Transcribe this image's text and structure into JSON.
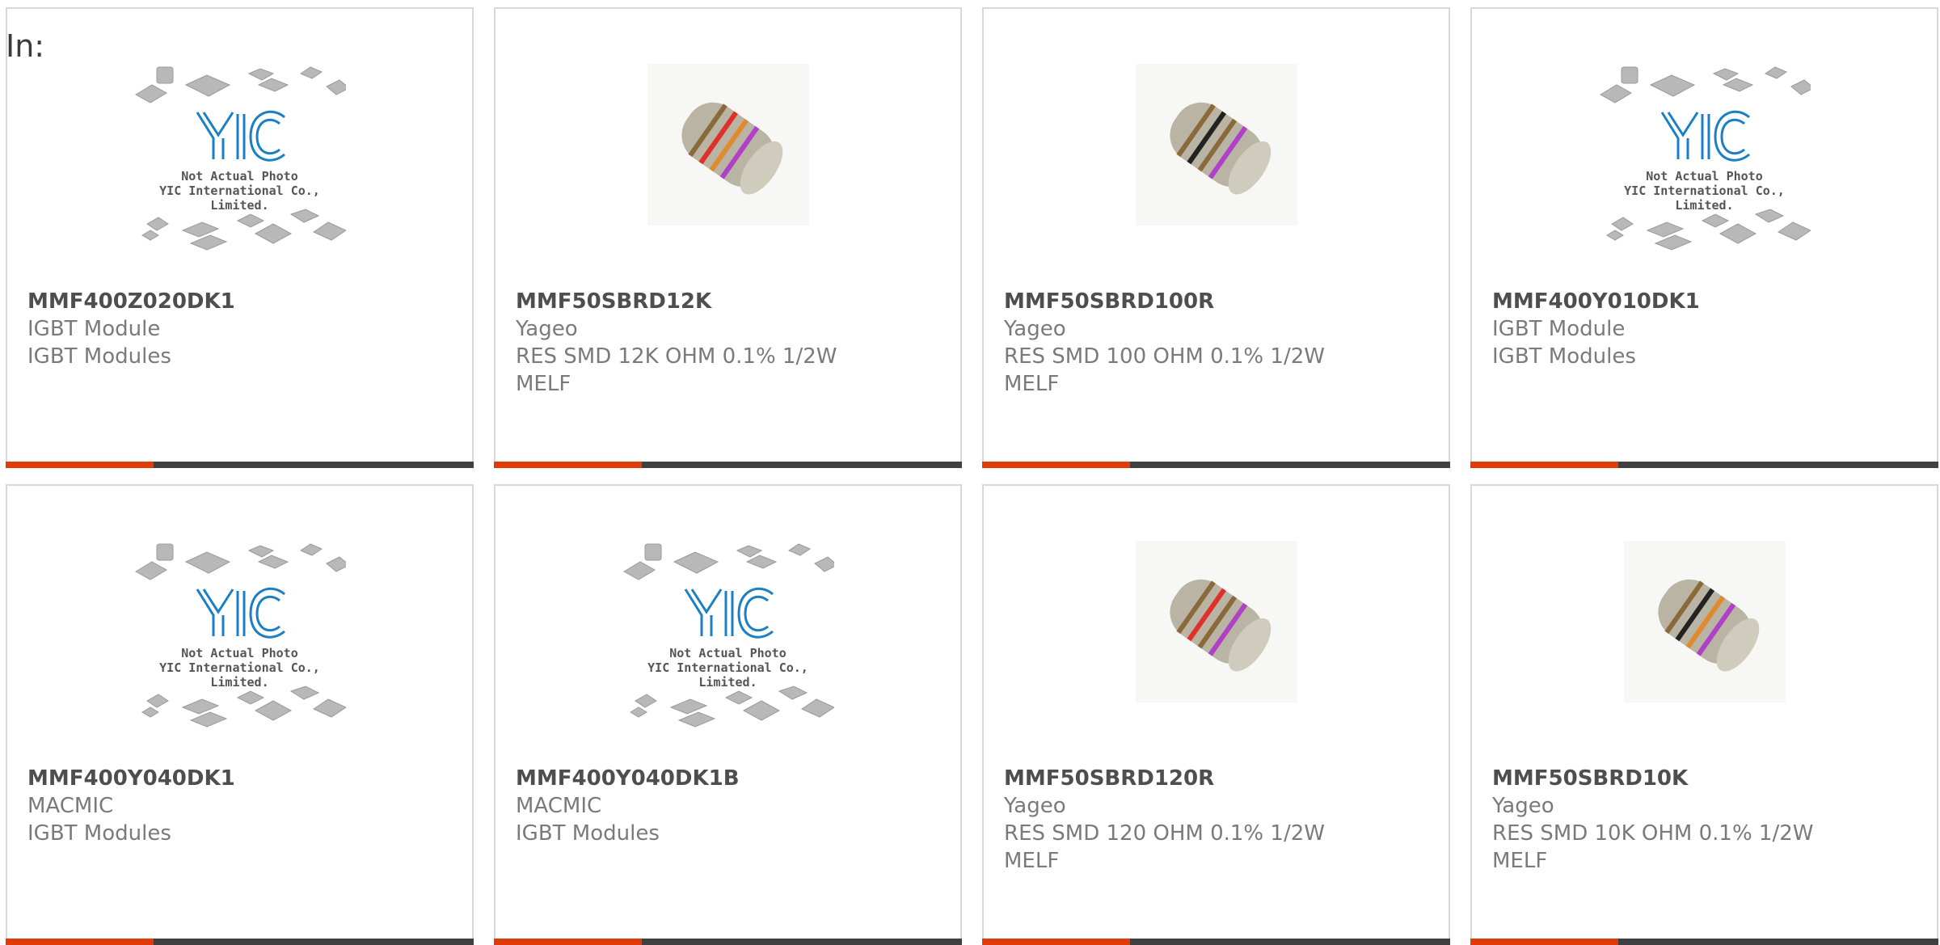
{
  "heading": "In:",
  "placeholder": {
    "line1": "Not Actual Photo",
    "line2": "YIC International Co., Limited."
  },
  "products": [
    {
      "part": "MMF400Z020DK1",
      "line1": "IGBT Module",
      "line2": "IGBT Modules",
      "line3": "",
      "image": "yic-placeholder"
    },
    {
      "part": "MMF50SBRD12K",
      "line1": "Yageo",
      "line2": "RES SMD 12K OHM 0.1% 1/2W",
      "line3": "MELF",
      "image": "resistor",
      "bands": [
        "#8a6a3a",
        "#e0302a",
        "#e08a30",
        "#b040c8"
      ]
    },
    {
      "part": "MMF50SBRD100R",
      "line1": "Yageo",
      "line2": "RES SMD 100 OHM 0.1% 1/2W",
      "line3": "MELF",
      "image": "resistor",
      "bands": [
        "#8a6a3a",
        "#222222",
        "#8a6a3a",
        "#b040c8"
      ]
    },
    {
      "part": "MMF400Y010DK1",
      "line1": "IGBT Module",
      "line2": "IGBT Modules",
      "line3": "",
      "image": "yic-placeholder"
    },
    {
      "part": "MMF400Y040DK1",
      "line1": "MACMIC",
      "line2": "IGBT Modules",
      "line3": "",
      "image": "yic-placeholder"
    },
    {
      "part": "MMF400Y040DK1B",
      "line1": "MACMIC",
      "line2": "IGBT Modules",
      "line3": "",
      "image": "yic-placeholder"
    },
    {
      "part": "MMF50SBRD120R",
      "line1": "Yageo",
      "line2": "RES SMD 120 OHM 0.1% 1/2W",
      "line3": "MELF",
      "image": "resistor",
      "bands": [
        "#8a6a3a",
        "#e0302a",
        "#8a6a3a",
        "#b040c8"
      ]
    },
    {
      "part": "MMF50SBRD10K",
      "line1": "Yageo",
      "line2": "RES SMD 10K OHM 0.1% 1/2W",
      "line3": "MELF",
      "image": "resistor",
      "bands": [
        "#8a6a3a",
        "#222222",
        "#e08a30",
        "#b040c8"
      ]
    }
  ],
  "colors": {
    "accent": "#e23b0a",
    "bar": "#404040",
    "logo": "#1a7fc4"
  }
}
